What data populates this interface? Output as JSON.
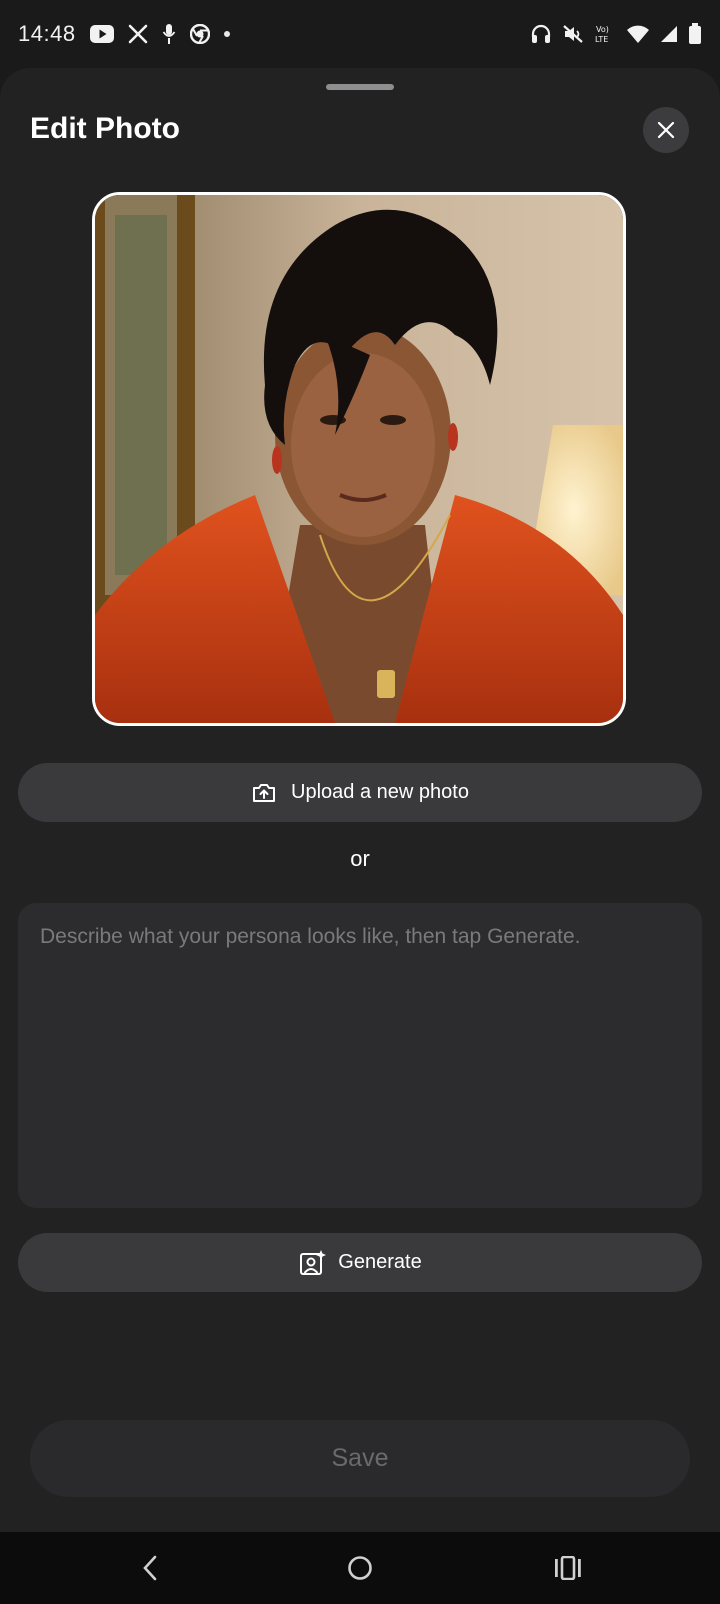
{
  "status_bar": {
    "time": "14:48",
    "left_icons": [
      "youtube-icon",
      "x-icon",
      "podcast-icon",
      "chrome-icon",
      "dot-icon"
    ],
    "right_icons": [
      "headphones-icon",
      "mute-icon",
      "volte-icon",
      "wifi-icon",
      "signal-icon",
      "battery-icon"
    ],
    "volte_label": "Vo⁠LTE"
  },
  "sheet": {
    "title": "Edit Photo",
    "close_icon": "close-icon"
  },
  "photo": {
    "alt": "Persona photo"
  },
  "upload": {
    "label": "Upload a new photo",
    "icon": "upload-image-icon"
  },
  "divider_text": "or",
  "prompt": {
    "placeholder": "Describe what your persona looks like, then tap Generate.",
    "value": ""
  },
  "generate": {
    "label": "Generate",
    "icon": "generate-image-icon"
  },
  "save": {
    "label": "Save"
  },
  "nav": {
    "items": [
      "back-icon",
      "home-icon",
      "recents-icon"
    ]
  },
  "colors": {
    "background": "#1a1a1b",
    "sheet": "#222223",
    "button": "#3a3a3c",
    "input": "#2c2c2e",
    "disabled_text": "#6a6a6d"
  }
}
